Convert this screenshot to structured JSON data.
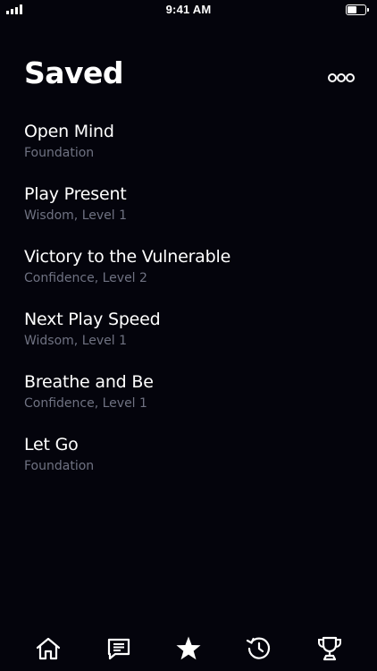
{
  "status_bar": {
    "time": "9:41 AM",
    "battery_level": 0.55
  },
  "header": {
    "title": "Saved",
    "more_icon": "ellipsis-icon"
  },
  "saved_items": [
    {
      "title": "Open Mind",
      "subtitle": "Foundation"
    },
    {
      "title": "Play Present",
      "subtitle": "Wisdom, Level 1"
    },
    {
      "title": "Victory to the Vulnerable",
      "subtitle": "Confidence, Level 2"
    },
    {
      "title": "Next Play Speed",
      "subtitle": "Widsom, Level 1"
    },
    {
      "title": "Breathe and Be",
      "subtitle": "Confidence, Level 1"
    },
    {
      "title": "Let Go",
      "subtitle": "Foundation"
    }
  ],
  "tab_bar": {
    "tabs": [
      {
        "icon": "home-icon"
      },
      {
        "icon": "chat-icon"
      },
      {
        "icon": "star-icon",
        "active": true
      },
      {
        "icon": "history-icon"
      },
      {
        "icon": "trophy-icon"
      }
    ]
  },
  "colors": {
    "background": "#04040c",
    "text_primary": "#ffffff",
    "text_secondary": "#6f7282"
  }
}
